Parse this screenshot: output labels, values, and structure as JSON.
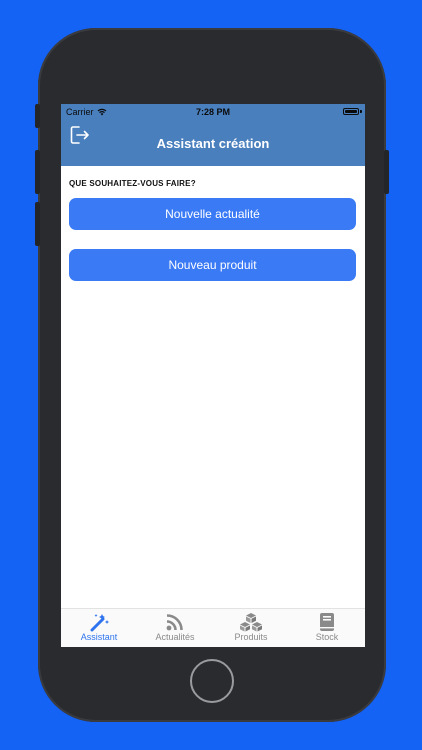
{
  "status_bar": {
    "carrier": "Carrier",
    "time": "7:28 PM"
  },
  "nav": {
    "title": "Assistant création",
    "logout_icon": "logout-icon"
  },
  "content": {
    "section_title": "QUE SOUHAITEZ-VOUS FAIRE?",
    "actions": [
      {
        "label": "Nouvelle actualité"
      },
      {
        "label": "Nouveau produit"
      }
    ]
  },
  "tab_bar": {
    "tabs": [
      {
        "label": "Assistant",
        "icon": "magic-wand-icon",
        "active": true
      },
      {
        "label": "Actualités",
        "icon": "rss-icon",
        "active": false
      },
      {
        "label": "Produits",
        "icon": "boxes-icon",
        "active": false
      },
      {
        "label": "Stock",
        "icon": "book-icon",
        "active": false
      }
    ]
  },
  "colors": {
    "background": "#1463f5",
    "nav_bar": "#4a7fbd",
    "button": "#3a7af5",
    "tab_active": "#2f74ee",
    "tab_inactive": "#8a8a8a"
  }
}
